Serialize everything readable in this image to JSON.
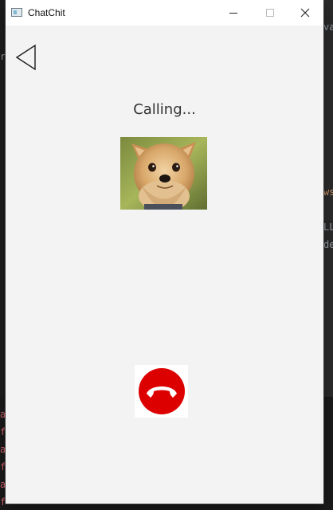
{
  "window": {
    "title": "ChatChit"
  },
  "controls": {
    "minimize": "minimize",
    "maximize": "maximize",
    "close": "close"
  },
  "call": {
    "status": "Calling...",
    "avatar_icon": "contact-avatar-dog",
    "back_icon": "back-arrow-icon",
    "hangup_icon": "hang-up-phone-icon"
  },
  "colors": {
    "hangup_red": "#dd0000",
    "window_bg": "#f3f3f3",
    "titlebar_bg": "#ffffff"
  },
  "background": {
    "fragments": [
      "va",
      "r",
      "ws",
      "LL",
      "de",
      "a",
      "f",
      "a",
      "f",
      "a",
      "f"
    ]
  }
}
